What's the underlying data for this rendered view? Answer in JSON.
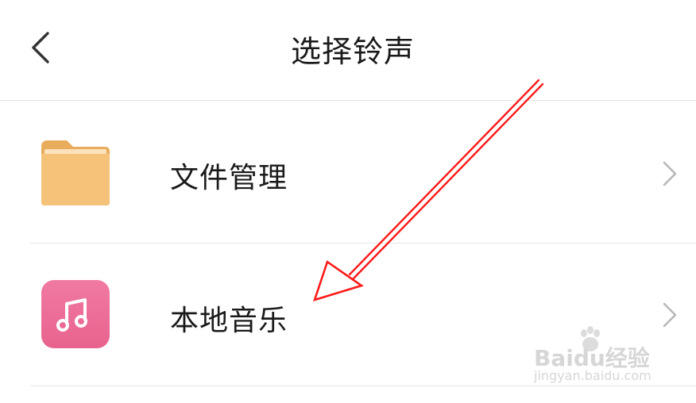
{
  "header": {
    "title": "选择铃声",
    "back_icon": "chevron-left-icon"
  },
  "list": {
    "items": [
      {
        "label": "文件管理",
        "icon": "folder-icon",
        "icon_color": "#f5c27a",
        "chevron_icon": "chevron-right-icon"
      },
      {
        "label": "本地音乐",
        "icon": "music-note-icon",
        "icon_color": "#ec6f97",
        "chevron_icon": "chevron-right-icon"
      }
    ]
  },
  "annotation": {
    "arrow_color": "#ff0000"
  },
  "watermark": {
    "brand": "Baidu经验",
    "url": "jingyan.baidu.com"
  }
}
